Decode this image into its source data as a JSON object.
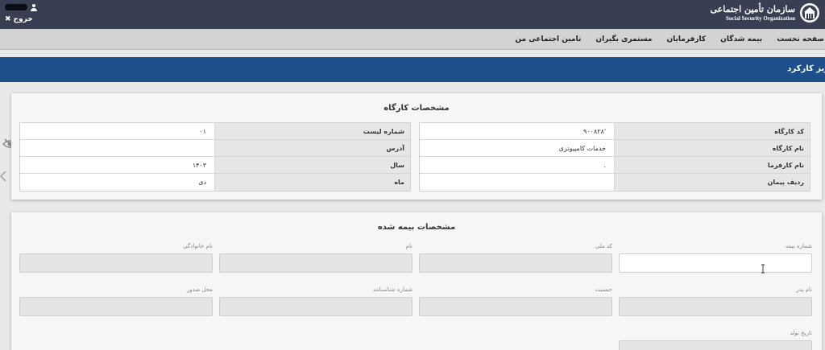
{
  "topbar": {
    "logout_label": "خروج",
    "logo_fa": "سازمان تأمین اجتماعی",
    "logo_en": "Social Security Organization"
  },
  "nav": {
    "items": [
      "صفحه نخست",
      "بیمه شدگان",
      "کارفرمایان",
      "مستمری بگیران",
      "تامین اجتماعی من"
    ]
  },
  "page": {
    "title": "ریز کارکرد"
  },
  "workshop": {
    "title": "مشخصات کارگاه",
    "right_rows": [
      {
        "label": "کد کارگاه",
        "value": "۹۰۰۸۲۸'"
      },
      {
        "label": "نام کارگاه",
        "value": "خدمات کامپیوتری"
      },
      {
        "label": "نام کارفرما",
        "value": "."
      },
      {
        "label": "ردیف پیمان",
        "value": ""
      }
    ],
    "left_rows": [
      {
        "label": "شماره لیست",
        "value": "۰۱"
      },
      {
        "label": "آدرس",
        "value": ""
      },
      {
        "label": "سال",
        "value": "۱۴۰۳"
      },
      {
        "label": "ماه",
        "value": "دی"
      }
    ]
  },
  "insured": {
    "title": "مشخصات بیمه شده",
    "row1": [
      "شماره بیمه",
      "کد ملی",
      "نام",
      "نام خانوادگی"
    ],
    "row2": [
      "نام پدر",
      "جنسیت",
      "شماره شناسنامه",
      "محل صدور"
    ],
    "row3": [
      "تاریخ تولد"
    ]
  },
  "icons": {
    "user": "user-icon",
    "logout": "close-icon",
    "logo": "ssorg-logo-icon",
    "eye": "eye-slash-icon",
    "scroll": "chevron-left-icon",
    "cursor": "text-cursor-icon"
  },
  "colors": {
    "topbar": "#383f52",
    "navbar": "#d3d3d3",
    "page_header": "#1f4f8a",
    "card": "#f6f6f6",
    "label_cell": "#e6e6e6"
  }
}
